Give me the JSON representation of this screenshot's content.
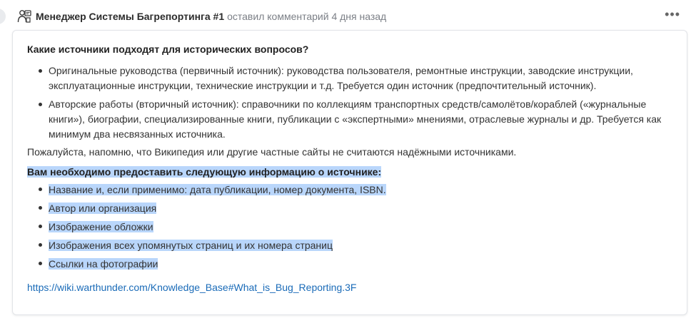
{
  "comment": {
    "author": "Менеджер Системы Багрепортинга #1",
    "meta": "оставил комментарий 4 дня назад",
    "more_label": "•••"
  },
  "body": {
    "question": "Какие источники подходят для исторических вопросов?",
    "sources": [
      "Оригинальные руководства (первичный источник): руководства пользователя, ремонтные инструкции, заводские инструкции, эксплуатационные инструкции, технические инструкции и т.д. Требуется один источник (предпочтительный источник).",
      "Авторские работы (вторичный источник): справочники по коллекциям транспортных средств/самолётов/кораблей («журнальные книги»), биографии, специализированные книги, публикации с «экспертными» мнениями, отраслевые журналы и др. Требуется как минимум два несвязанных источника."
    ],
    "note": "Пожалуйста, напомню, что Википедия или другие частные сайты не считаются надёжными источниками.",
    "info_title": "Вам необходимо предоставить следующую информацию о источнике:",
    "info_items": [
      "Название и, если применимо: дата публикации, номер документа, ISBN.",
      "Автор или организация",
      "Изображение обложки",
      "Изображения всех упомянутых страниц и их номера страниц",
      "Ссылки на фотографии"
    ],
    "link": "https://wiki.warthunder.com/Knowledge_Base#What_is_Bug_Reporting.3F"
  },
  "colors": {
    "highlight": "#b9d6fb",
    "link": "#1a6bb8",
    "meta": "#7b7f86"
  },
  "icons": {
    "avatar": "manager-avatar-icon",
    "more": "more-options-icon"
  }
}
